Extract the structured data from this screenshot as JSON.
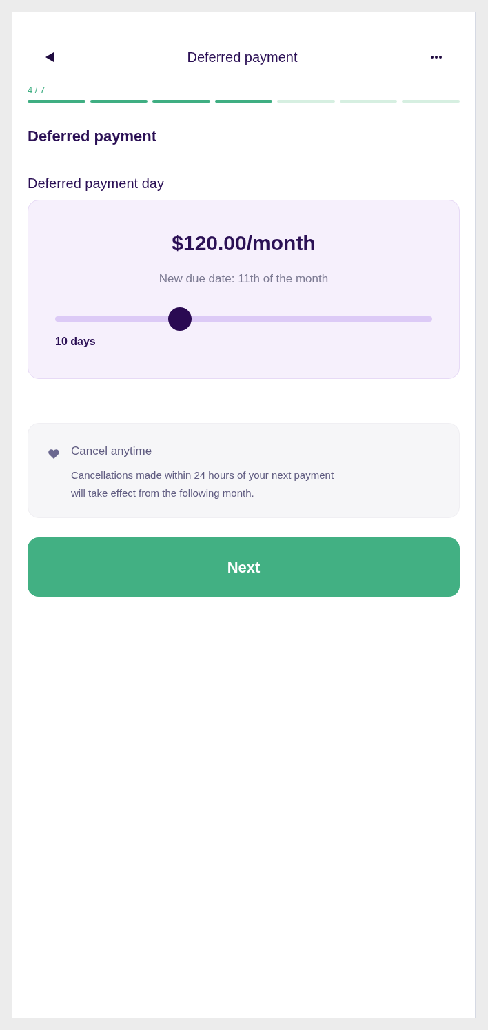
{
  "header": {
    "title": "Deferred payment"
  },
  "progress": {
    "label": "4 / 7",
    "steps": [
      {
        "completed": true
      },
      {
        "completed": true
      },
      {
        "completed": true
      },
      {
        "completed": true
      },
      {
        "completed": false
      },
      {
        "completed": false
      },
      {
        "completed": false
      }
    ]
  },
  "section_title": "Deferred payment",
  "field_label": "Deferred payment day",
  "payment_card": {
    "amount": "$120.00/month",
    "due_date": "New due date: 11th of the month",
    "slider": {
      "level": 0.33,
      "reading": "10 days"
    }
  },
  "info_card": {
    "title": "Cancel anytime",
    "text": "Cancellations made within 24 hours of your next payment will take effect from the following month."
  },
  "buttons": [
    {
      "kind": "primary",
      "label": "Next"
    }
  ]
}
